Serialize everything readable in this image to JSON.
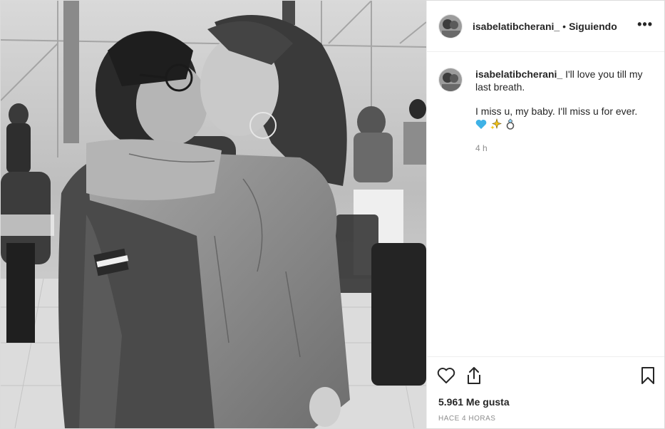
{
  "post": {
    "username": "isabelatibcherani_",
    "separator": "•",
    "follow_status": "Siguiendo",
    "more_label": "•••",
    "caption": {
      "username": "isabelatibcherani_",
      "line1": "I'll love you till my last breath.",
      "line2": "I miss u, my baby. I'll miss u for ever.",
      "emojis": [
        "blue-heart",
        "sparkles",
        "ring"
      ],
      "time": "4 h"
    },
    "likes": "5.961 Me gusta",
    "posted_ago": "HACE 4 HORAS"
  },
  "photo": {
    "description_icon": "black-and-white-photo",
    "tone": "grayscale"
  }
}
